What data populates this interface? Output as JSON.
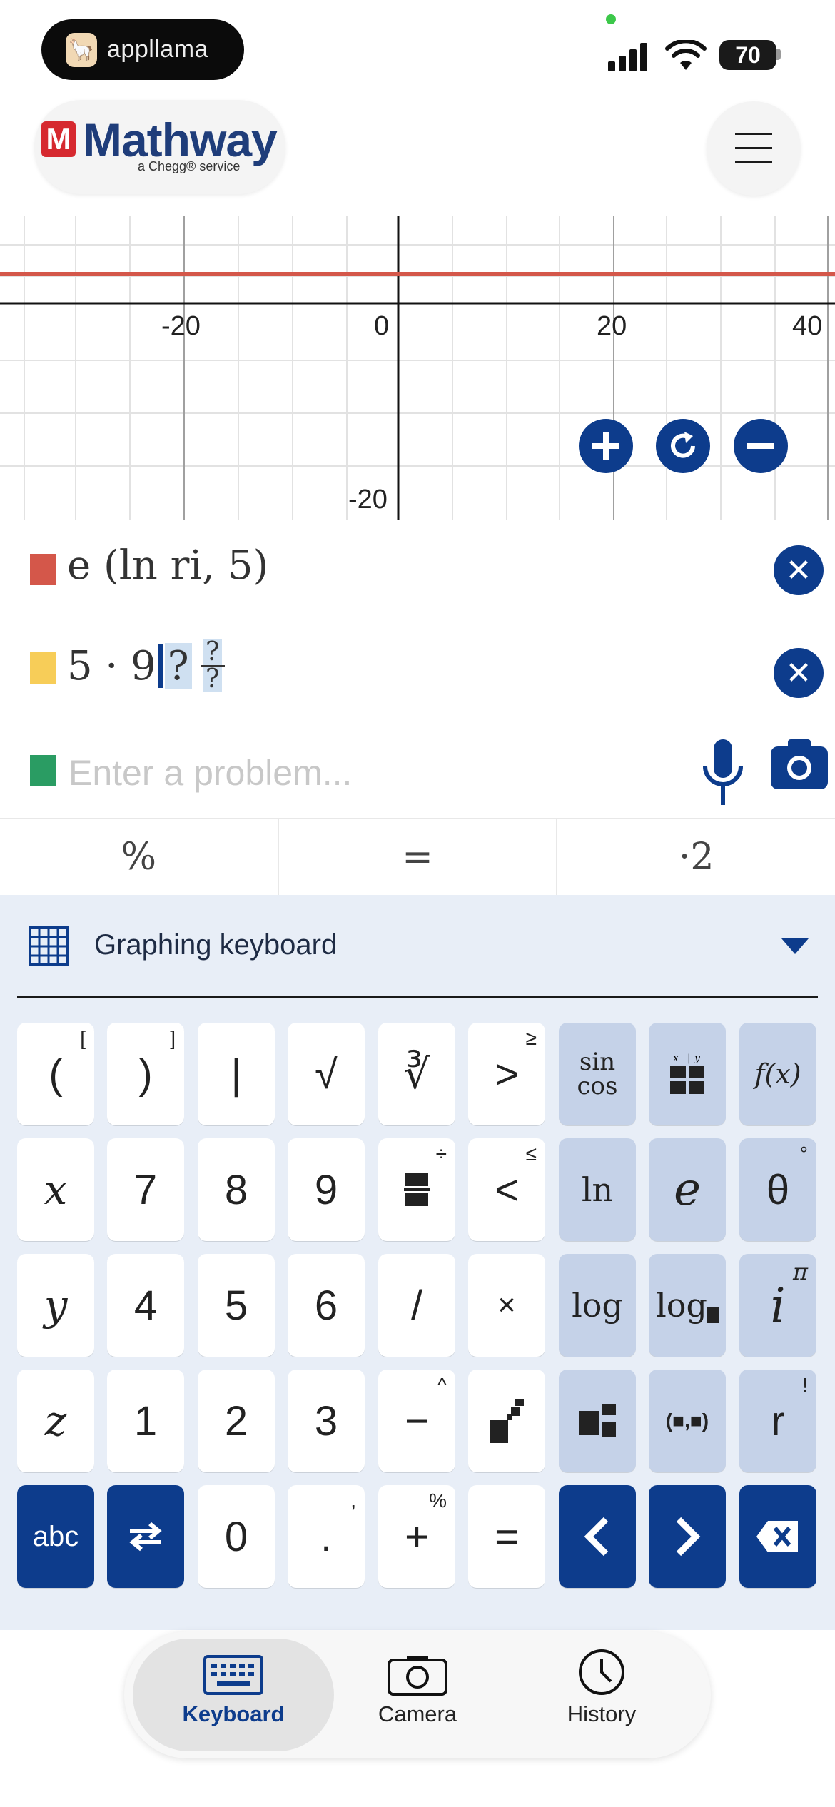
{
  "status_bar": {
    "app_name": "appllama",
    "battery": "70"
  },
  "header": {
    "logo_mark": "M",
    "logo_text": "Mathway",
    "logo_sub": "a Chegg® service"
  },
  "graph": {
    "x_ticks": [
      "-20",
      "0",
      "20",
      "40"
    ],
    "y_ticks": [
      "-20"
    ],
    "line_color": "#d4574a"
  },
  "expressions": [
    {
      "color": "#d4574a",
      "text": "e (ln ri, 5)"
    },
    {
      "color": "#f7cd58",
      "prefix": "5 · 9",
      "placeholder": "?",
      "frac_num": "?",
      "frac_den": "?"
    }
  ],
  "input": {
    "color": "#2a9c63",
    "placeholder": "Enter a problem..."
  },
  "suggestions": [
    "%",
    "=",
    "·2"
  ],
  "keyboard": {
    "title": "Graphing keyboard",
    "rows": [
      [
        "(",
        ")",
        "|",
        "√",
        "∛",
        ">",
        "sin cos",
        "",
        "f(x)"
      ],
      [
        "x",
        "7",
        "8",
        "9",
        "",
        "<",
        "ln",
        "e",
        "θ"
      ],
      [
        "y",
        "4",
        "5",
        "6",
        "/",
        "×",
        "log",
        "log",
        "i"
      ],
      [
        "z",
        "1",
        "2",
        "3",
        "−",
        "",
        "",
        "(■,■)",
        "r"
      ],
      [
        "abc",
        "",
        "0",
        ".",
        "+",
        "=",
        "",
        "",
        ""
      ]
    ],
    "superscripts": {
      "open_paren": "[",
      "close_paren": "]",
      "greater": "≥",
      "less": "≤",
      "divide_sup": "÷",
      "theta_sup": "°",
      "i_sup": "π",
      "minus_sup": "^",
      "r_sup": "!",
      "dot_sup": ",",
      "plus_sup": "%"
    }
  },
  "tabs": [
    {
      "label": "Keyboard",
      "icon": "keyboard-icon",
      "active": true
    },
    {
      "label": "Camera",
      "icon": "camera-icon",
      "active": false
    },
    {
      "label": "History",
      "icon": "clock-icon",
      "active": false
    }
  ],
  "colors": {
    "brand_blue": "#0d3c8c",
    "keyboard_bg": "#e8eef7",
    "func_key": "#c5d2e8"
  }
}
